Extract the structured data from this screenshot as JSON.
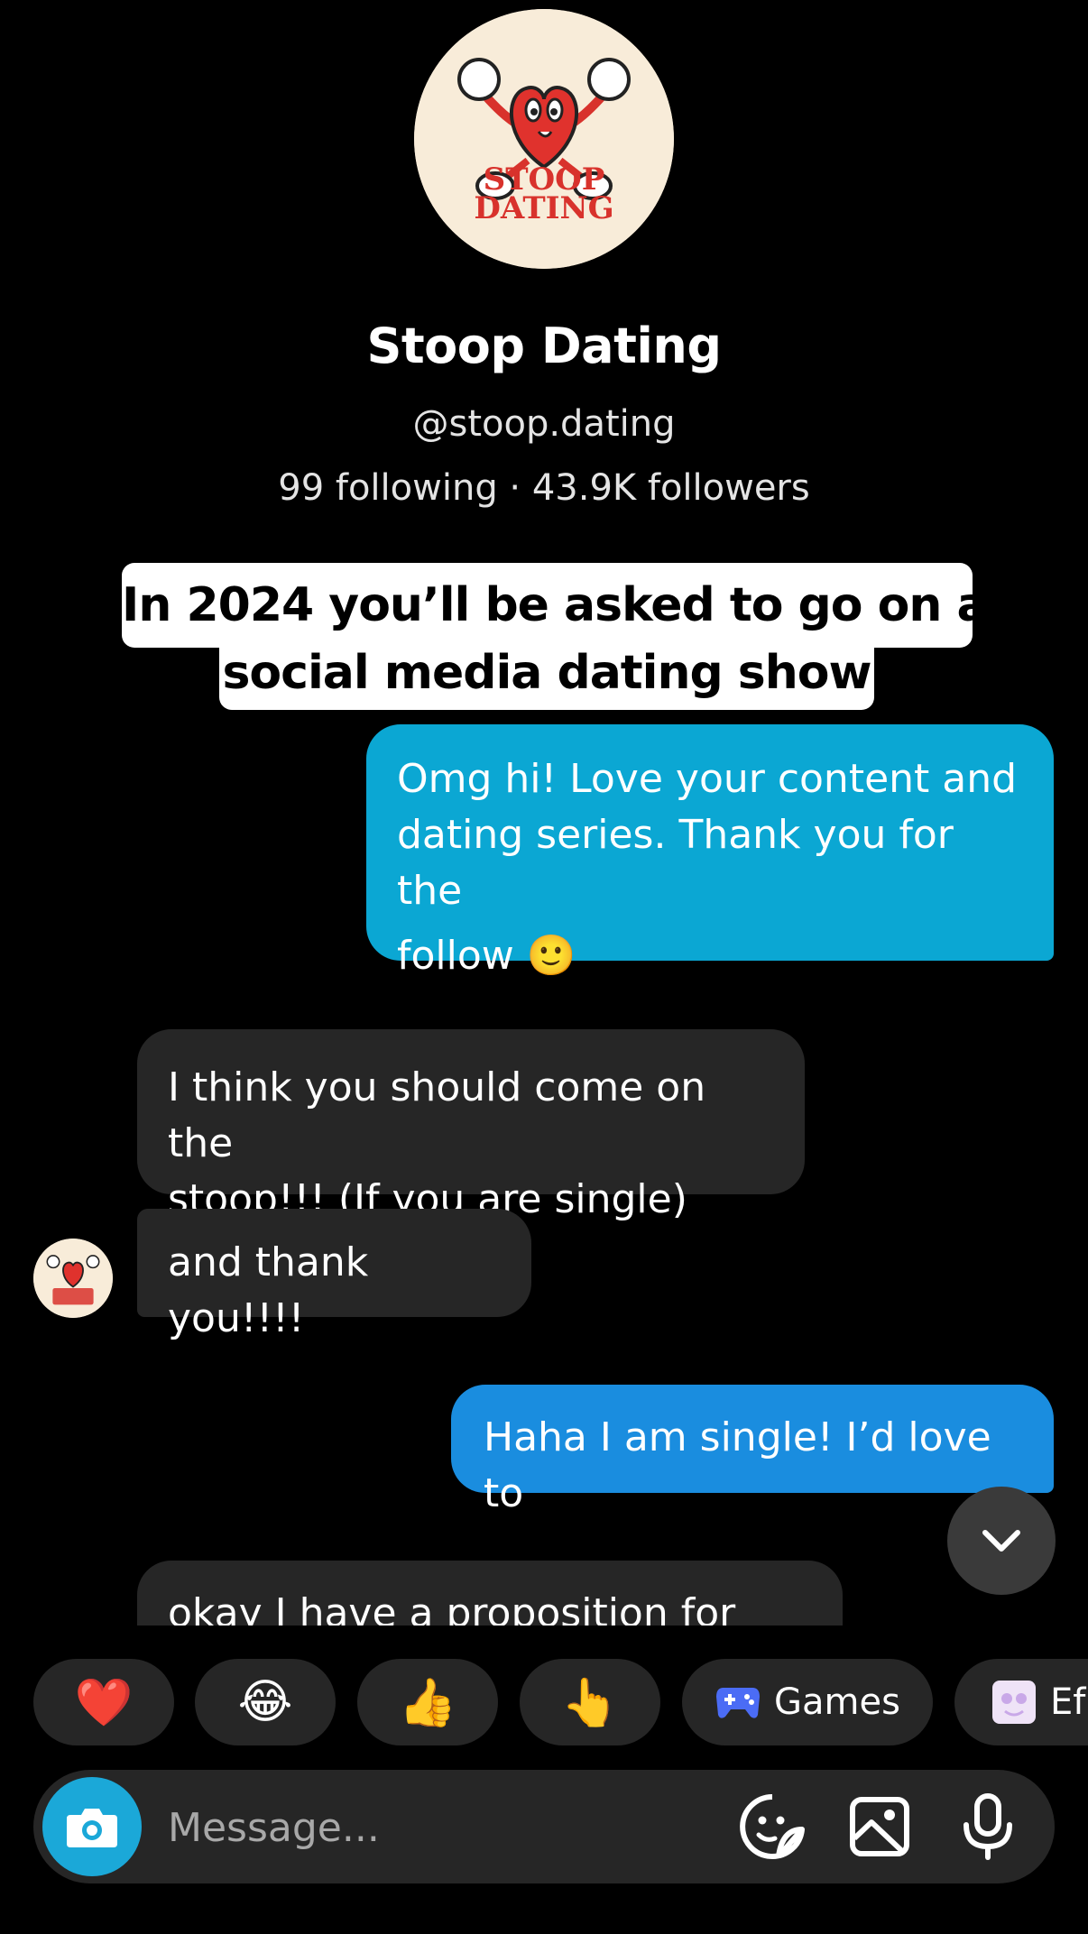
{
  "profile": {
    "name": "Stoop Dating",
    "handle": "@stoop.dating",
    "stats": "99 following · 43.9K followers",
    "logo_text_line1": "STOOP",
    "logo_text_line2": "DATING"
  },
  "caption": {
    "line1": "In 2024 you’ll be asked to go on a",
    "line2": "social media dating show"
  },
  "messages": [
    {
      "direction": "outgoing",
      "lines": [
        "Omg hi! Love your content and",
        "dating series. Thank you for the",
        "follow 🙂"
      ]
    },
    {
      "direction": "incoming",
      "lines": [
        "I think you should come on the",
        "stoop!!! (If you are single)"
      ]
    },
    {
      "direction": "incoming",
      "text": "and thank you!!!!"
    },
    {
      "direction": "outgoing",
      "text": "Haha I am single! I’d love to"
    },
    {
      "direction": "incoming",
      "text": "okay I have a proposition for you"
    }
  ],
  "quick_reactions": [
    {
      "emoji": "❤️",
      "icon": "heart-emoji"
    },
    {
      "emoji": "😂",
      "icon": "laughing-emoji"
    },
    {
      "emoji": "👍",
      "icon": "thumbs-up-emoji"
    },
    {
      "emoji": "👆",
      "icon": "pointing-emoji"
    },
    {
      "label": "Games",
      "icon": "gamepad-icon"
    },
    {
      "label": "Ef",
      "icon": "effects-icon"
    }
  ],
  "composer": {
    "placeholder": "Message...",
    "icons": [
      "camera-icon",
      "sticker-icon",
      "photo-icon",
      "microphone-icon"
    ]
  },
  "colors": {
    "background": "#000000",
    "outgoing_bubble": "#0ba7d3",
    "incoming_bubble": "#262626",
    "camera_button": "#1ba8d8"
  }
}
